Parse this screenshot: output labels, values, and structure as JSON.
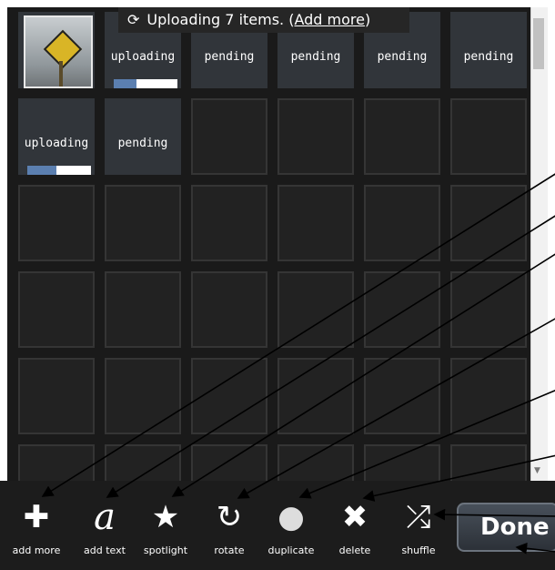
{
  "status": {
    "icon": "refresh-icon",
    "text_before": "Uploading 7 items. (",
    "link": "Add more",
    "text_after": ")"
  },
  "tiles": [
    {
      "state": "thumbnail",
      "image": "yellow-road-sign-photo"
    },
    {
      "state": "uploading",
      "progress": 0.35
    },
    {
      "state": "pending"
    },
    {
      "state": "pending"
    },
    {
      "state": "pending"
    },
    {
      "state": "pending"
    },
    {
      "state": "uploading",
      "progress": 0.45
    },
    {
      "state": "pending"
    }
  ],
  "labels": {
    "uploading": "uploading",
    "pending": "pending"
  },
  "toolbar": {
    "tools": [
      {
        "icon": "plus-icon",
        "glyph": "✚",
        "label": "add more"
      },
      {
        "icon": "text-a-icon",
        "glyph": "a",
        "label": "add text"
      },
      {
        "icon": "star-icon",
        "glyph": "★",
        "label": "spotlight"
      },
      {
        "icon": "rotate-icon",
        "glyph": "↻",
        "label": "rotate"
      },
      {
        "icon": "duplicate-circles-icon",
        "glyph": "●",
        "label": "duplicate"
      },
      {
        "icon": "x-icon",
        "glyph": "✖",
        "label": "delete"
      },
      {
        "icon": "shuffle-icon",
        "glyph": "⤮",
        "label": "shuffle"
      }
    ],
    "done_label": "Done"
  },
  "colors": {
    "background": "#1a1a1a",
    "tile_filled": "#31353a",
    "progress": "#5b7fb0",
    "toolbar": "#1c1c1c"
  }
}
